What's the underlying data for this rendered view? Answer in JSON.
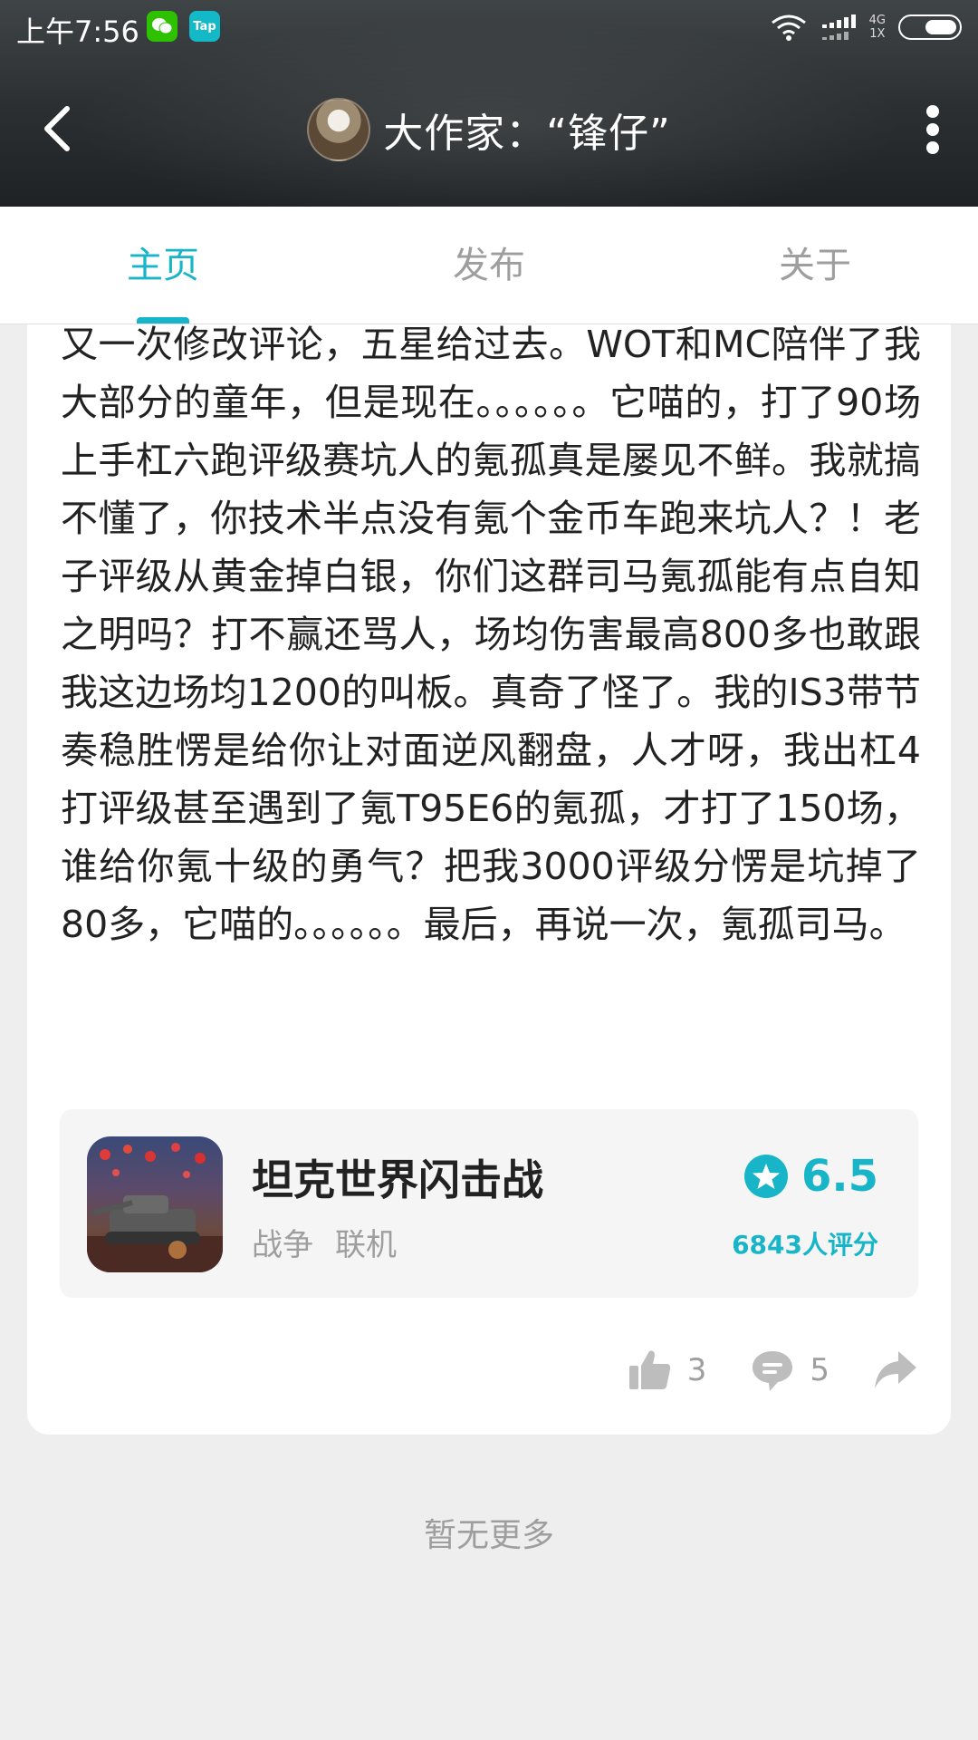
{
  "status_bar": {
    "time": "上午7:56",
    "apps": [
      "wechat-icon",
      "tap-icon"
    ],
    "tap_label": "Tap",
    "network_top": "4G",
    "network_bottom": "1X"
  },
  "header": {
    "title": "大作家：“锋仔”"
  },
  "tabs": [
    {
      "label": "主页",
      "active": true
    },
    {
      "label": "发布",
      "active": false
    },
    {
      "label": "关于",
      "active": false
    }
  ],
  "review": {
    "text": "又一次修改评论，五星给过去。WOT和MC陪伴了我大部分的童年，但是现在。。。。。。它喵的，打了90场上手杠六跑评级赛坑人的氪孤真是屡见不鲜。我就搞不懂了，你技术半点没有氪个金币车跑来坑人？！老子评级从黄金掉白银，你们这群司马氪孤能有点自知之明吗？打不赢还骂人，场均伤害最高800多也敢跟我这边场均1200的叫板。真奇了怪了。我的IS3带节奏稳胜愣是给你让对面逆风翻盘，人才呀，我出杠4打评级甚至遇到了氪T95E6的氪孤，才打了150场，谁给你氪十级的勇气？把我3000评级分愣是坑掉了80多，它喵的。。。。。。最后，再说一次，氪孤司马。"
  },
  "game": {
    "name": "坦克世界闪击战",
    "tags": [
      "战争",
      "联机"
    ],
    "rating": "6.5",
    "rating_count": "6843人评分"
  },
  "actions": {
    "likes": "3",
    "comments": "5"
  },
  "footer": {
    "no_more": "暂无更多"
  },
  "colors": {
    "accent": "#18b4c8",
    "header_bg": "#2c3032",
    "page_bg": "#eeeeee",
    "muted": "#9e9e9e"
  }
}
